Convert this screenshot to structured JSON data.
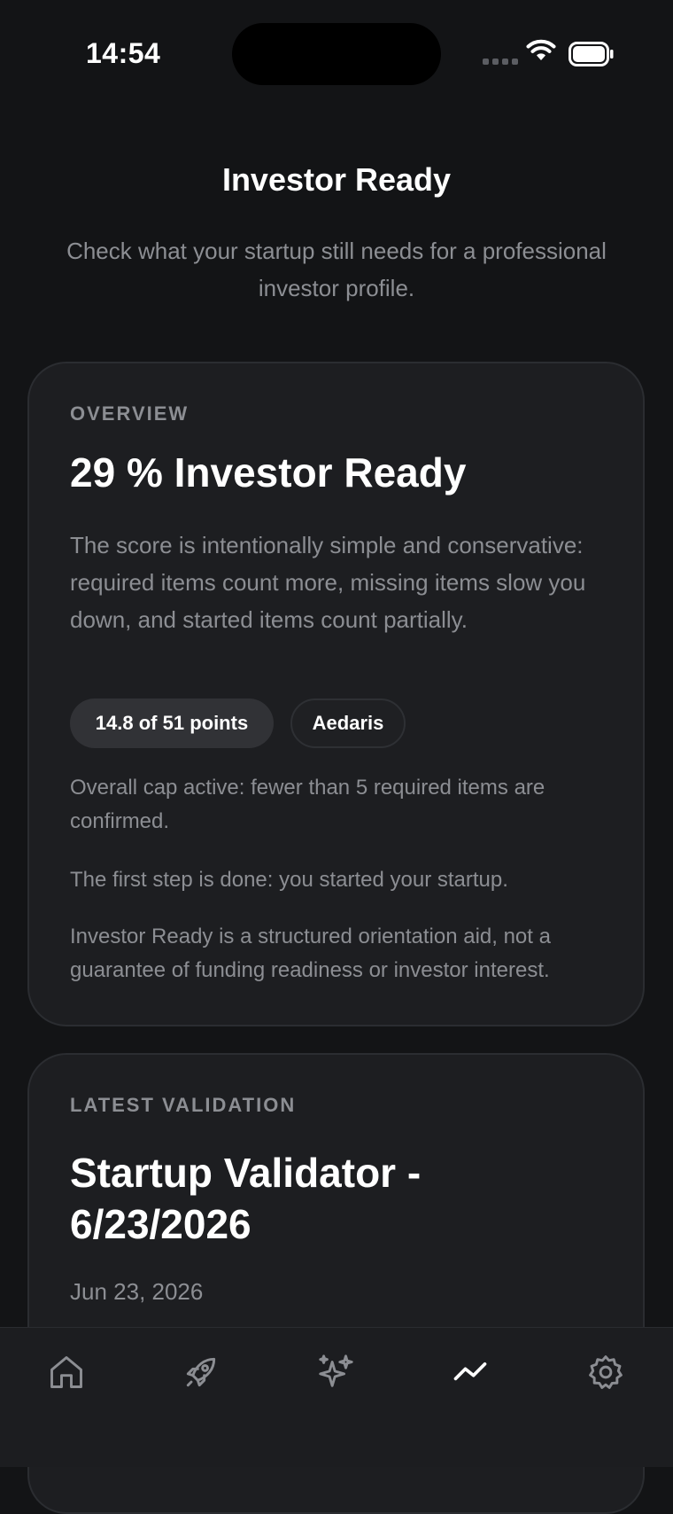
{
  "status_bar": {
    "time": "14:54"
  },
  "header": {
    "title": "Investor Ready",
    "subtitle": "Check what your startup still needs for a professional investor profile."
  },
  "overview_card": {
    "eyebrow": "OVERVIEW",
    "title": "29 % Investor Ready",
    "description": "The score is intentionally simple and conservative: required items count more, missing items slow you down, and started items count partially.",
    "points_chip": "14.8 of 51 points",
    "startup_chip": "Aedaris",
    "cap_note": "Overall cap active: fewer than 5 required items are confirmed.",
    "first_step_note": "The first step is done: you started your startup.",
    "disclaimer": "Investor Ready is a structured orientation aid, not a guarantee of funding readiness or investor interest."
  },
  "validation_card": {
    "eyebrow": "LATEST VALIDATION",
    "title": "Startup Validator - 6/23/2026",
    "date": "Jun 23, 2026"
  },
  "tab_bar": {
    "items": [
      {
        "icon": "home-icon",
        "active": false
      },
      {
        "icon": "rocket-icon",
        "active": false
      },
      {
        "icon": "sparkles-icon",
        "active": false
      },
      {
        "icon": "chart-line-icon",
        "active": true
      },
      {
        "icon": "gear-icon",
        "active": false
      }
    ]
  },
  "colors": {
    "background": "#131416",
    "card": "#1d1e21",
    "muted_text": "#8c8e93",
    "inactive_icon": "#8c8e93",
    "active_icon": "#ffffff"
  }
}
